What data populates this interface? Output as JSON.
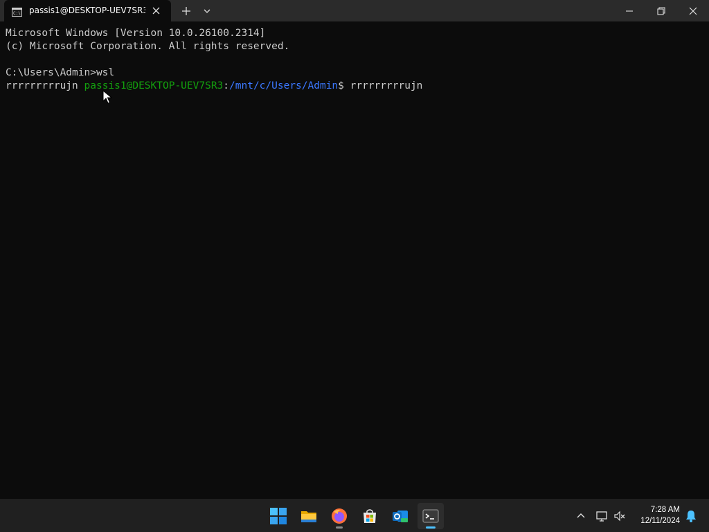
{
  "tab": {
    "title": "passis1@DESKTOP-UEV7SR3: ,"
  },
  "terminal": {
    "line1": "Microsoft Windows [Version 10.0.26100.2314]",
    "line2": "(c) Microsoft Corporation. All rights reserved.",
    "line3": "C:\\Users\\Admin>wsl",
    "prefix": "rrrrrrrrrujn ",
    "prompt_user": "passis1@DESKTOP-UEV7SR3",
    "prompt_colon": ":",
    "prompt_path": "/mnt/c/Users/Admin",
    "prompt_symbol": "$ ",
    "command": "rrrrrrrrrujn"
  },
  "taskbar": {
    "apps": [
      "start-icon",
      "file-explorer-icon",
      "firefox-icon",
      "microsoft-store-icon",
      "outlook-new-icon",
      "terminal-icon"
    ],
    "active_app": "terminal-icon"
  },
  "clock": {
    "time": "7:28 AM",
    "date": "12/11/2024"
  },
  "colors": {
    "prompt_user": "#13a10e",
    "prompt_path": "#3b78ff",
    "accent": "#4cc2ff"
  }
}
